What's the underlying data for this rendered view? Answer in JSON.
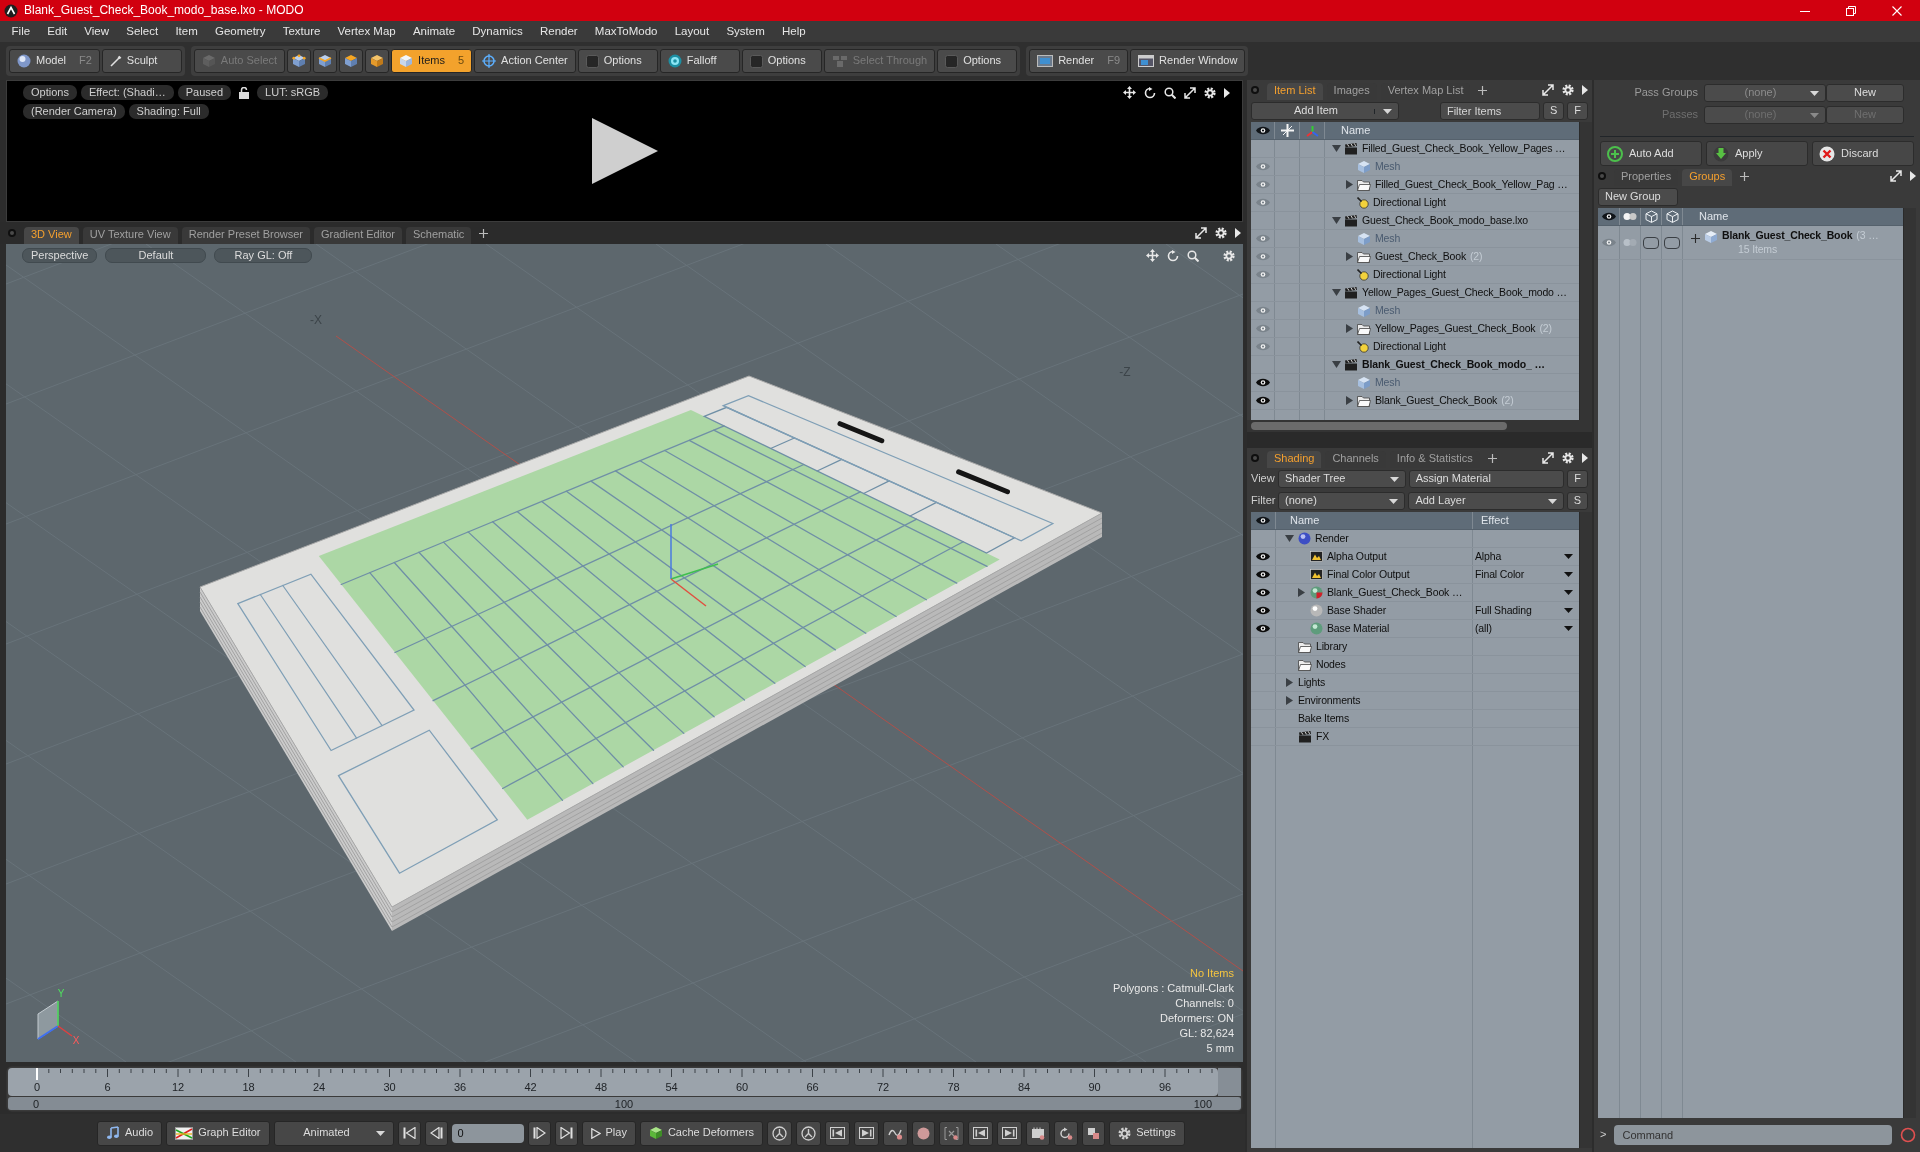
{
  "window": {
    "title": "Blank_Guest_Check_Book_modo_base.lxo - MODO"
  },
  "menu": [
    "File",
    "Edit",
    "View",
    "Select",
    "Item",
    "Geometry",
    "Texture",
    "Vertex Map",
    "Animate",
    "Dynamics",
    "Render",
    "MaxToModo",
    "Layout",
    "System",
    "Help"
  ],
  "toolbar": [
    [
      {
        "kind": "button",
        "label": "Model",
        "shortcut": "F2",
        "selected": false,
        "disabled": false
      },
      {
        "kind": "button",
        "label": "Sculpt",
        "selected": false,
        "disabled": false
      }
    ],
    [
      {
        "kind": "button",
        "label": "Auto Select",
        "selected": false,
        "disabled": true
      },
      {
        "kind": "icon",
        "selected": false,
        "disabled": false
      },
      {
        "kind": "icon",
        "selected": false,
        "disabled": false
      },
      {
        "kind": "icon",
        "selected": false,
        "disabled": false
      },
      {
        "kind": "icon",
        "selected": false,
        "disabled": false
      },
      {
        "kind": "button",
        "label": "Items",
        "shortcut": "5",
        "selected": true,
        "disabled": false
      },
      {
        "kind": "button",
        "label": "Action Center",
        "selected": false,
        "disabled": false
      },
      {
        "kind": "button",
        "label": "Options",
        "selected": false,
        "disabled": false
      },
      {
        "kind": "button",
        "label": "Falloff",
        "selected": false,
        "disabled": false
      },
      {
        "kind": "button",
        "label": "Options",
        "selected": false,
        "disabled": false
      },
      {
        "kind": "button",
        "label": "Select Through",
        "selected": false,
        "disabled": true
      },
      {
        "kind": "button",
        "label": "Options",
        "selected": false,
        "disabled": false
      }
    ],
    [
      {
        "kind": "button",
        "label": "Render",
        "shortcut": "F9",
        "selected": false,
        "disabled": false
      },
      {
        "kind": "button",
        "label": "Render Window",
        "selected": false,
        "disabled": false
      }
    ]
  ],
  "render_preview": {
    "rows": [
      [
        {
          "kind": "pill",
          "label": "Options"
        },
        {
          "kind": "pill",
          "label": "Effect: (Shadi…"
        },
        {
          "kind": "pill",
          "label": "Paused"
        },
        {
          "kind": "lock"
        },
        {
          "kind": "pill",
          "label": "LUT: sRGB"
        }
      ],
      [
        {
          "kind": "pill",
          "label": "(Render Camera)"
        },
        {
          "kind": "pill",
          "label": "Shading: Full"
        }
      ]
    ]
  },
  "viewport_tabs": [
    {
      "label": "3D View",
      "selected": true
    },
    {
      "label": "UV Texture View",
      "selected": false
    },
    {
      "label": "Render Preset Browser",
      "selected": false
    },
    {
      "label": "Gradient Editor",
      "selected": false
    },
    {
      "label": "Schematic",
      "selected": false
    }
  ],
  "viewport": {
    "buttons": [
      "Perspective",
      "Default",
      "Ray GL: Off"
    ],
    "grid_labels": [
      "-X",
      "-Z"
    ],
    "axis_labels": [
      "Y",
      "X"
    ],
    "info": [
      {
        "kind": "alert",
        "text": "No Items"
      },
      {
        "kind": "plain",
        "text": "Polygons : Catmull-Clark"
      },
      {
        "kind": "plain",
        "text": "Channels: 0"
      },
      {
        "kind": "plain",
        "text": "Deformers: ON"
      },
      {
        "kind": "plain",
        "text": "GL: 82,624"
      },
      {
        "kind": "plain",
        "text": "5 mm"
      }
    ]
  },
  "timeline": {
    "ticks": [
      "0",
      "6",
      "12",
      "18",
      "24",
      "30",
      "36",
      "42",
      "48",
      "54",
      "60",
      "66",
      "72",
      "78",
      "84",
      "90",
      "96"
    ],
    "range_labels": [
      "0",
      "100",
      "100"
    ]
  },
  "bottom_toolbar": [
    {
      "kind": "button",
      "label": "Audio"
    },
    {
      "kind": "button",
      "label": "Graph Editor"
    },
    {
      "kind": "dropdown",
      "label": "Animated"
    },
    {
      "kind": "icon"
    },
    {
      "kind": "icon"
    },
    {
      "kind": "field",
      "value": "0"
    },
    {
      "kind": "icon"
    },
    {
      "kind": "icon"
    },
    {
      "kind": "button",
      "label": "Play"
    },
    {
      "kind": "button",
      "label": "Cache Deformers"
    },
    {
      "kind": "icon"
    },
    {
      "kind": "icon"
    },
    {
      "kind": "icon"
    },
    {
      "kind": "icon"
    },
    {
      "kind": "icon"
    },
    {
      "kind": "icon"
    },
    {
      "kind": "icon"
    },
    {
      "kind": "icon"
    },
    {
      "kind": "icon"
    },
    {
      "kind": "icon"
    },
    {
      "kind": "icon"
    },
    {
      "kind": "icon"
    },
    {
      "kind": "button",
      "label": "Settings"
    }
  ],
  "item_list": {
    "tabs": [
      {
        "label": "Item List",
        "selected": true
      },
      {
        "label": "Images",
        "selected": false
      },
      {
        "label": "Vertex Map List",
        "selected": false
      }
    ],
    "add_item": "Add Item",
    "filter": {
      "placeholder": "Filter Items"
    },
    "filter_buttons": [
      "S",
      "F"
    ],
    "column": "Name",
    "items": [
      {
        "kind": "scene",
        "name": "Filled_Guest_Check_Book_Yellow_Pages …",
        "visible": false,
        "expanded": true,
        "current": false,
        "children": [
          {
            "kind": "mesh",
            "name": "Mesh",
            "visible": true
          },
          {
            "kind": "group",
            "name": "Filled_Guest_Check_Book_Yellow_Pag …",
            "visible": true,
            "expanded": false
          },
          {
            "kind": "light",
            "name": "Directional Light",
            "visible": true
          }
        ]
      },
      {
        "kind": "scene",
        "name": "Guest_Check_Book_modo_base.lxo",
        "visible": false,
        "expanded": true,
        "current": false,
        "children": [
          {
            "kind": "mesh",
            "name": "Mesh",
            "visible": true
          },
          {
            "kind": "group",
            "name": "Guest_Check_Book",
            "count": "(2)",
            "visible": true,
            "expanded": false
          },
          {
            "kind": "light",
            "name": "Directional Light",
            "visible": true
          }
        ]
      },
      {
        "kind": "scene",
        "name": "Yellow_Pages_Guest_Check_Book_modo …",
        "visible": false,
        "expanded": true,
        "current": false,
        "children": [
          {
            "kind": "mesh",
            "name": "Mesh",
            "visible": true
          },
          {
            "kind": "group",
            "name": "Yellow_Pages_Guest_Check_Book",
            "count": "(2)",
            "visible": true,
            "expanded": false
          },
          {
            "kind": "light",
            "name": "Directional Light",
            "visible": true
          }
        ]
      },
      {
        "kind": "scene",
        "name": "Blank_Guest_Check_Book_modo_ …",
        "visible": false,
        "expanded": true,
        "current": true,
        "children": [
          {
            "kind": "mesh",
            "name": "Mesh",
            "visible": true
          },
          {
            "kind": "group",
            "name": "Blank_Guest_Check_Book",
            "count": "(2)",
            "visible": true,
            "expanded": false
          }
        ]
      }
    ]
  },
  "shading": {
    "tabs": [
      {
        "label": "Shading",
        "selected": true
      },
      {
        "label": "Channels",
        "selected": false
      },
      {
        "label": "Info & Statistics",
        "selected": false
      }
    ],
    "view_label": "View",
    "view": "Shader Tree",
    "assign": "Assign Material",
    "assign_button": "F",
    "filter_label": "Filter",
    "filter": "(none)",
    "add_layer": "Add Layer",
    "add_layer_button": "S",
    "columns": [
      "Name",
      "Effect"
    ],
    "items": [
      {
        "kind": "render",
        "name": "Render",
        "visible": false,
        "expanded": true,
        "children": [
          {
            "kind": "output",
            "name": "Alpha Output",
            "visible": true,
            "effect": "Alpha"
          },
          {
            "kind": "output",
            "name": "Final Color Output",
            "visible": true,
            "effect": "Final Color"
          },
          {
            "kind": "material-group",
            "name": "Blank_Guest_Check_Book …",
            "visible": true,
            "expanded": false
          },
          {
            "kind": "shader",
            "name": "Base Shader",
            "visible": true,
            "effect": "Full Shading"
          },
          {
            "kind": "material",
            "name": "Base Material",
            "visible": true,
            "effect": "(all)"
          }
        ]
      },
      {
        "kind": "folder",
        "name": "Library",
        "visible": false
      },
      {
        "kind": "folder",
        "name": "Nodes",
        "visible": false
      },
      {
        "kind": "category",
        "name": "Lights",
        "visible": false,
        "expanded": false
      },
      {
        "kind": "category",
        "name": "Environments",
        "visible": false,
        "expanded": false
      },
      {
        "kind": "category",
        "name": "Bake Items",
        "visible": false
      },
      {
        "kind": "fx",
        "name": "FX",
        "visible": false
      }
    ]
  },
  "passes": {
    "rows": [
      {
        "label": "Pass Groups",
        "value": "(none)",
        "button": "New",
        "disabled": false
      },
      {
        "label": "Passes",
        "value": "(none)",
        "button": "New",
        "disabled": true
      }
    ],
    "actions": [
      "Auto Add",
      "Apply",
      "Discard"
    ]
  },
  "groups": {
    "tabs": [
      {
        "label": "Properties",
        "selected": false
      },
      {
        "label": "Groups",
        "selected": true
      }
    ],
    "new_group": "New Group",
    "column": "Name",
    "items": [
      {
        "name": "Blank_Guest_Check_Book",
        "count": "(3 …",
        "subtitle": "15 Items"
      }
    ]
  },
  "command": {
    "prompt": ">",
    "placeholder": "Command"
  }
}
